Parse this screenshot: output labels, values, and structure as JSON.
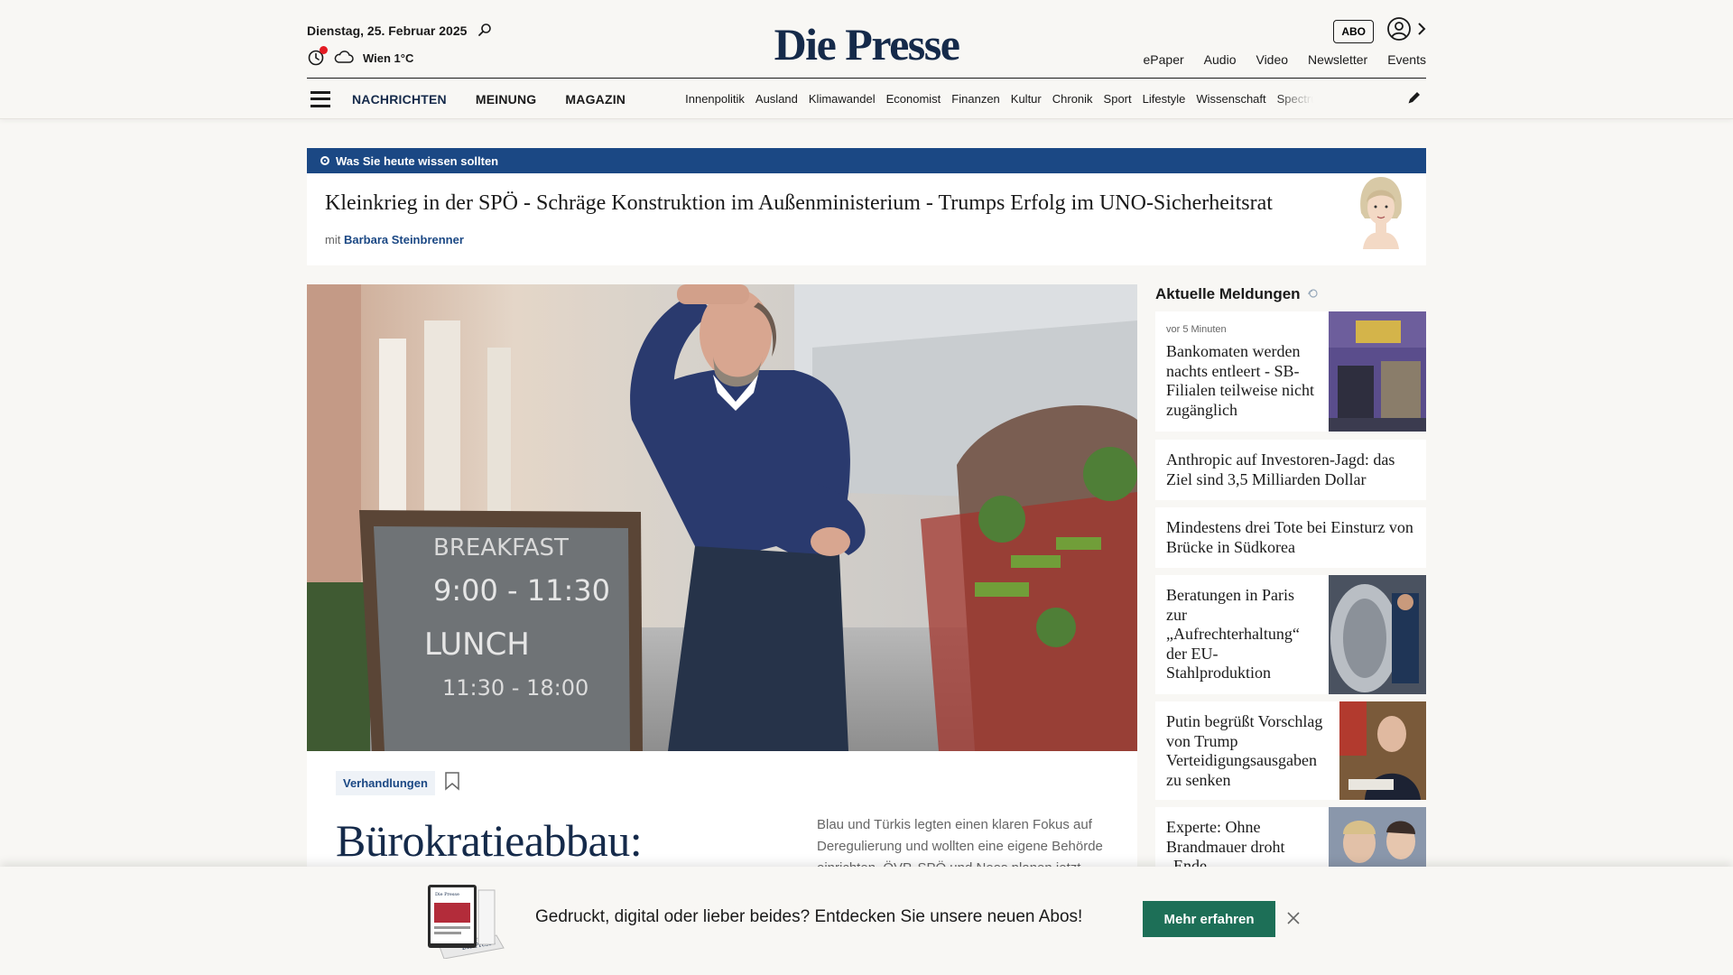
{
  "header": {
    "date": "Dienstag, 25. Februar 2025",
    "weather": "Wien 1°C",
    "logo": "Die Presse",
    "abo": "ABO",
    "links": [
      "ePaper",
      "Audio",
      "Video",
      "Newsletter",
      "Events"
    ]
  },
  "nav": {
    "main": [
      "NACHRICHTEN",
      "MEINUNG",
      "MAGAZIN"
    ],
    "sub": [
      "Innenpolitik",
      "Ausland",
      "Klimawandel",
      "Economist",
      "Finanzen",
      "Kultur",
      "Chronik",
      "Sport",
      "Lifestyle",
      "Wissenschaft",
      "Spectrum"
    ]
  },
  "briefing": {
    "label": "Was Sie heute wissen sollten",
    "title": "Kleinkrieg in der SPÖ - Schräge Konstruktion im Außenministerium - Trumps Erfolg im UNO-Sicherheitsrat",
    "author_prefix": "mit",
    "author": "Barbara Steinbrenner"
  },
  "main_article": {
    "tag": "Verhandlungen",
    "headline": "Bürokratieabbau:",
    "teaser": "Blau und Türkis legten einen klaren Fokus auf Deregulierung und wollten eine eigene Behörde einrichten. ÖVP, SPÖ und Neos planen jetzt",
    "image_sign": [
      "BREAKFAST",
      "9:00 - 11:30",
      "LUNCH",
      "11:30 - 18:00"
    ]
  },
  "sidebar": {
    "heading": "Aktuelle Meldungen",
    "items": [
      {
        "meta": "vor 5 Minuten",
        "title": "Bankomaten werden nachts entleert - SB-Filialen teilweise nicht zugänglich"
      },
      {
        "title": "Anthropic auf Investoren-Jagd: das Ziel sind 3,5 Milliarden Dollar"
      },
      {
        "title": "Mindestens drei Tote bei Einsturz von Brücke in Südkorea"
      },
      {
        "title": "Beratungen in Paris zur „Aufrechterhaltung“ der EU-Stahlproduktion"
      },
      {
        "title": "Putin begrüßt Vorschlag von Trump Verteidigungsausgaben zu senken"
      },
      {
        "title": "Experte: Ohne Brandmauer droht „Ende"
      }
    ]
  },
  "banner": {
    "text": "Gedruckt, digital oder lieber beides? Entdecken Sie unsere neuen Abos!",
    "button": "Mehr erfahren",
    "mini_logo": "Die Presse"
  }
}
